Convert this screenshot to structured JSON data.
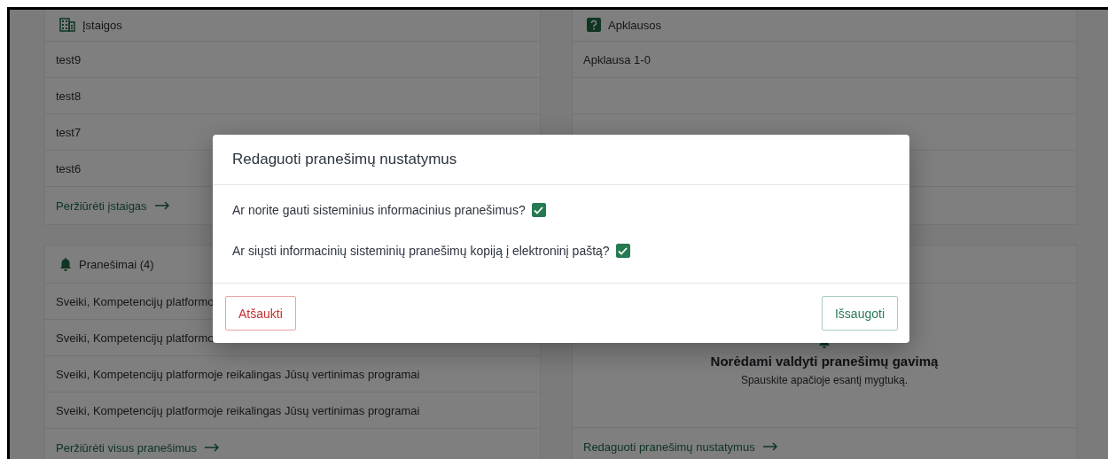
{
  "cards": [
    {
      "kind": "list",
      "title": "Įstaigos",
      "rows": [
        "test9",
        "test8",
        "test7",
        "test6"
      ],
      "link": "Peržiūrėti įstaigas"
    },
    {
      "kind": "list",
      "title": "Apklausos",
      "rows": [
        "Apklausa 1-0"
      ]
    },
    {
      "kind": "list",
      "title": "Pranešimai (4)",
      "rows": [
        "Sveiki, Kompetencijų platformo",
        "Sveiki, Kompetencijų platformo",
        "Sveiki, Kompetencijų platformoje reikalingas Jūsų vertinimas programai",
        "Sveiki, Kompetencijų platformoje reikalingas Jūsų vertinimas programai"
      ],
      "link": "Peržiūrėti visus pranešimus"
    },
    {
      "kind": "empty_state",
      "heading": "Norėdami valdyti pranešimų gavimą",
      "text": "Spauskite apačioje esantį mygtuką.",
      "link": "Redaguoti pranešimų nustatymus"
    }
  ],
  "dialog": {
    "title": "Redaguoti pranešimų nustatymus",
    "questions": [
      {
        "text": "Ar norite gauti sisteminius informacinius pranešimus?",
        "checked": true
      },
      {
        "text": "Ar siųsti informacinių sisteminių pranešimų kopiją į elektroninį paštą?",
        "checked": true
      }
    ],
    "cancel": "Atšaukti",
    "save": "Išsaugoti"
  }
}
